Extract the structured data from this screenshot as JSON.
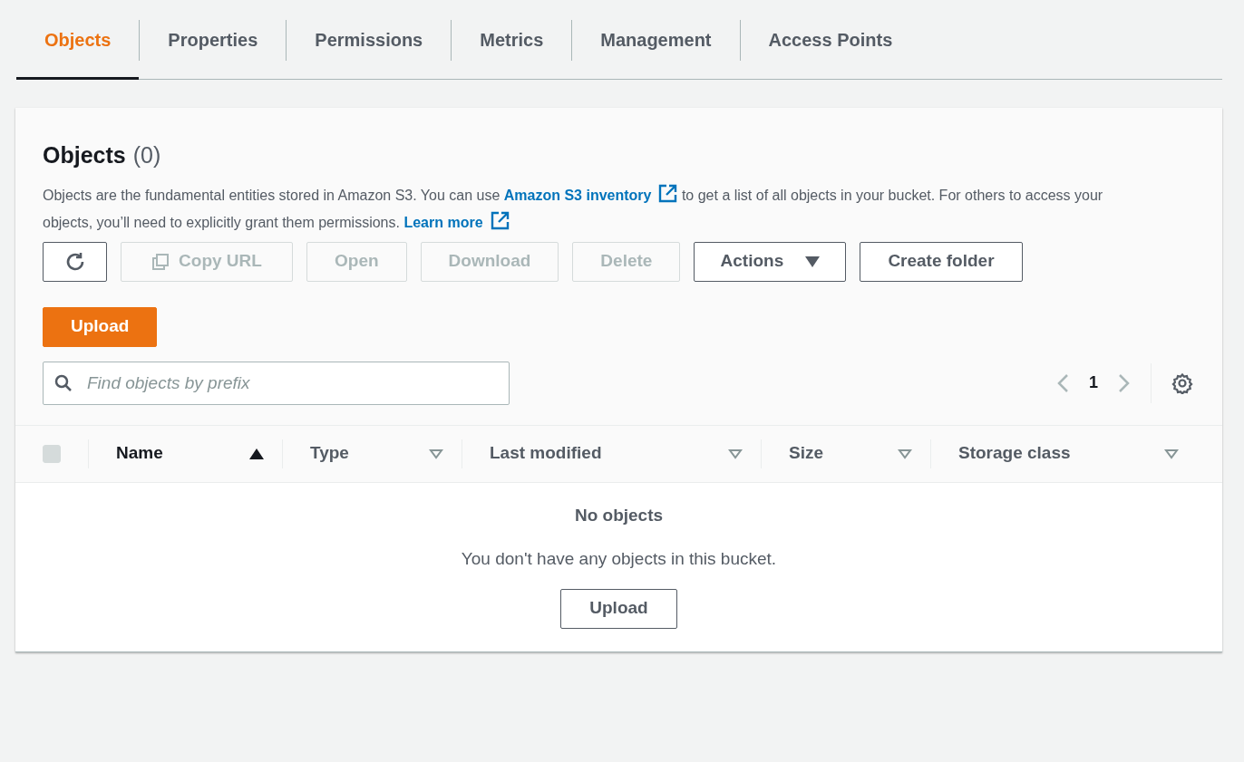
{
  "tabs": [
    {
      "label": "Objects",
      "selected": true
    },
    {
      "label": "Properties",
      "selected": false
    },
    {
      "label": "Permissions",
      "selected": false
    },
    {
      "label": "Metrics",
      "selected": false
    },
    {
      "label": "Management",
      "selected": false
    },
    {
      "label": "Access Points",
      "selected": false
    }
  ],
  "panel": {
    "title": "Objects",
    "count": "(0)",
    "description": [
      {
        "kind": "text",
        "text": "Objects are the fundamental entities stored in Amazon S3. You can use "
      },
      {
        "kind": "link",
        "text": "Amazon S3 inventory"
      },
      {
        "kind": "text",
        "text": " to get a list of all objects in your bucket. For others to access your objects, you’ll need to explicitly grant them permissions. "
      },
      {
        "kind": "link",
        "text": "Learn more"
      }
    ],
    "toolbar": [
      {
        "kind": "refresh",
        "disabled": false
      },
      {
        "kind": "copy",
        "label": "Copy URL",
        "disabled": true
      },
      {
        "kind": "plain",
        "label": "Open",
        "disabled": true
      },
      {
        "kind": "plain",
        "label": "Download",
        "disabled": true
      },
      {
        "kind": "plain",
        "label": "Delete",
        "disabled": true
      },
      {
        "kind": "dropdown",
        "label": "Actions",
        "disabled": false
      },
      {
        "kind": "plain",
        "label": "Create folder",
        "disabled": false
      },
      {
        "kind": "primary",
        "label": "Upload",
        "disabled": false
      }
    ],
    "search": {
      "placeholder": "Find objects by prefix"
    },
    "pagination": {
      "page": "1"
    },
    "table": {
      "select_all_checked": false,
      "columns": [
        {
          "label": "Name",
          "sorted": true
        },
        {
          "label": "Type",
          "sorted": false
        },
        {
          "label": "Last modified",
          "sorted": false
        },
        {
          "label": "Size",
          "sorted": false
        },
        {
          "label": "Storage class",
          "sorted": false
        }
      ],
      "empty": {
        "title": "No objects",
        "message": "You don't have any objects in this bucket.",
        "button": "Upload"
      }
    }
  }
}
